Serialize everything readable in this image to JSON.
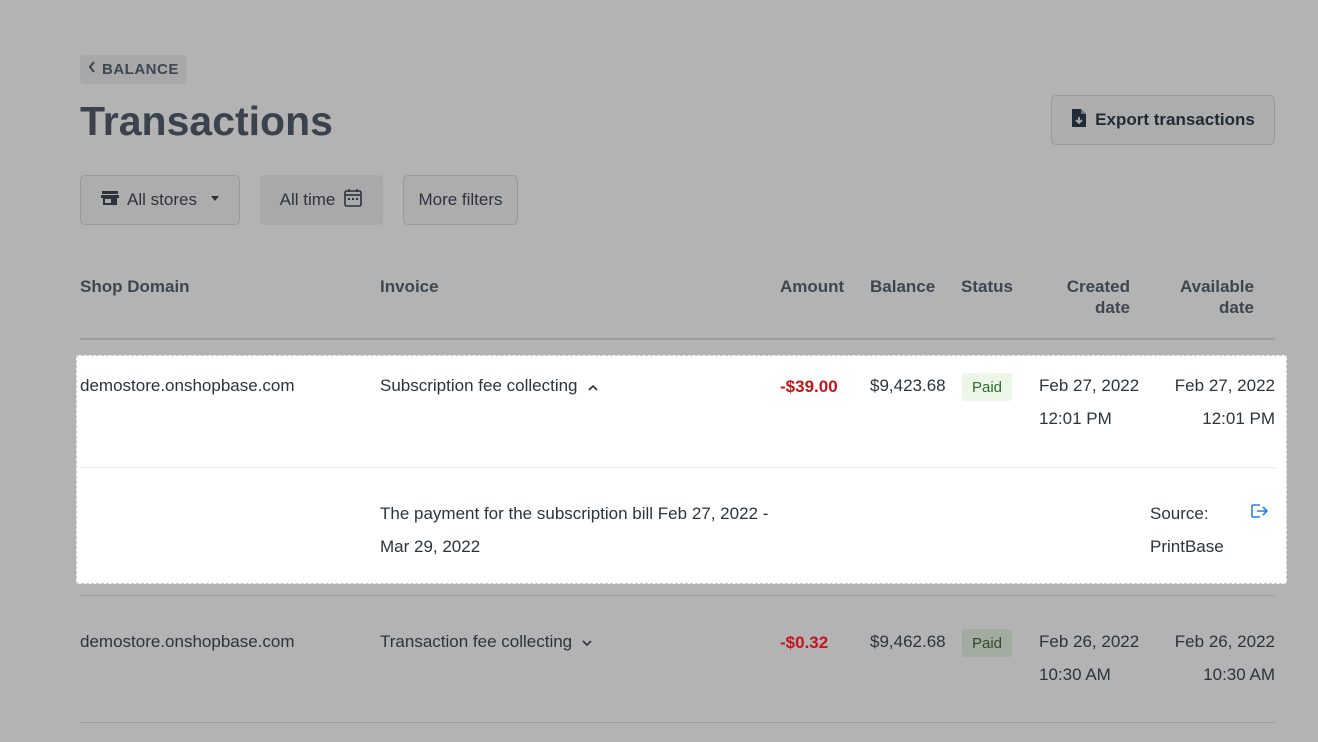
{
  "breadcrumb": {
    "label": "BALANCE"
  },
  "page": {
    "title": "Transactions"
  },
  "actions": {
    "export_label": "Export transactions"
  },
  "filters": {
    "stores": "All stores",
    "time": "All time",
    "more": "More filters"
  },
  "table": {
    "headers": {
      "shop_domain": "Shop Domain",
      "invoice": "Invoice",
      "amount": "Amount",
      "balance": "Balance",
      "status": "Status",
      "created_1": "Created",
      "created_2": "date",
      "available_1": "Available",
      "available_2": "date"
    },
    "rows": [
      {
        "shop_domain": "demostore.onshopbase.com",
        "invoice": "Subscription fee collecting",
        "amount": "-$39.00",
        "balance": "$9,423.68",
        "status": "Paid",
        "created_date": "Feb 27, 2022",
        "created_time": "12:01 PM",
        "available_date": "Feb 27, 2022",
        "available_time": "12:01 PM",
        "detail": {
          "description_1": "The payment for the subscription bill Feb 27, 2022 -",
          "description_2": "Mar 29, 2022",
          "source_label": "Source:",
          "source_value": "PrintBase"
        }
      },
      {
        "shop_domain": "demostore.onshopbase.com",
        "invoice": "Transaction fee collecting",
        "amount": "-$0.32",
        "balance": "$9,462.68",
        "status": "Paid",
        "created_date": "Feb 26, 2022",
        "created_time": "10:30 AM",
        "available_date": "Feb 26, 2022",
        "available_time": "10:30 AM"
      }
    ]
  },
  "colors": {
    "overlay": "#b3b3b3",
    "negative_amount": "#c4151c",
    "paid_badge_bg": "#ecf7e9",
    "link_icon": "#2a7de1"
  }
}
